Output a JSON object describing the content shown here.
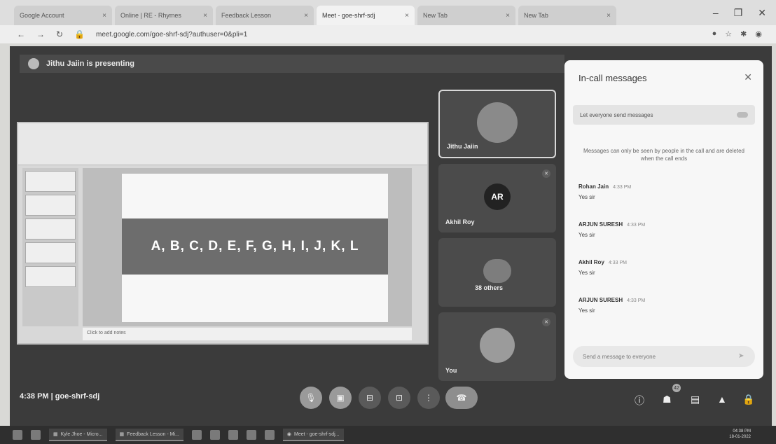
{
  "browser": {
    "tabs": [
      {
        "label": "Google Account",
        "active": false
      },
      {
        "label": "Online | RE - Rhymes",
        "active": false
      },
      {
        "label": "Feedback Lesson",
        "active": false
      },
      {
        "label": "Meet - goe-shrf-sdj",
        "active": true
      },
      {
        "label": "New Tab",
        "active": false
      },
      {
        "label": "New Tab",
        "active": false
      }
    ],
    "url": "meet.google.com/goe-shrf-sdj?authuser=0&pli=1"
  },
  "meet": {
    "presenting_banner": "Jithu Jaiin is presenting",
    "slide_text": "A, B, C, D, E, F, G, H, I, J, K, L",
    "notes_placeholder": "Click to add notes",
    "time_code": "4:38 PM | goe-shrf-sdj",
    "participants": [
      {
        "name": "Jithu Jaiin",
        "initials": "",
        "active": true
      },
      {
        "name": "Akhil Roy",
        "initials": "AR",
        "active": false
      },
      {
        "name": "38 others",
        "initials": "",
        "active": false
      },
      {
        "name": "You",
        "initials": "",
        "active": false
      }
    ],
    "people_count": "42"
  },
  "chat": {
    "title": "In-call messages",
    "toggle_label": "Let everyone send messages",
    "note": "Messages can only be seen by people in the call and are deleted when the call ends",
    "messages": [
      {
        "sender": "Rohan Jain",
        "time": "4:33 PM",
        "text": "Yes sir"
      },
      {
        "sender": "ARJUN SURESH",
        "time": "4:33 PM",
        "text": "Yes sir"
      },
      {
        "sender": "Akhil Roy",
        "time": "4:33 PM",
        "text": "Yes sir"
      },
      {
        "sender": "ARJUN SURESH",
        "time": "4:33 PM",
        "text": "Yes sir"
      }
    ],
    "input_placeholder": "Send a message to everyone"
  },
  "taskbar": {
    "apps": [
      "Kyle Jhoe - Micro...",
      "Feedback Lesson - Mi...",
      "Meet - goe-shrf-sdj..."
    ],
    "time": "04:38 PM",
    "date": "18-01-2022"
  }
}
